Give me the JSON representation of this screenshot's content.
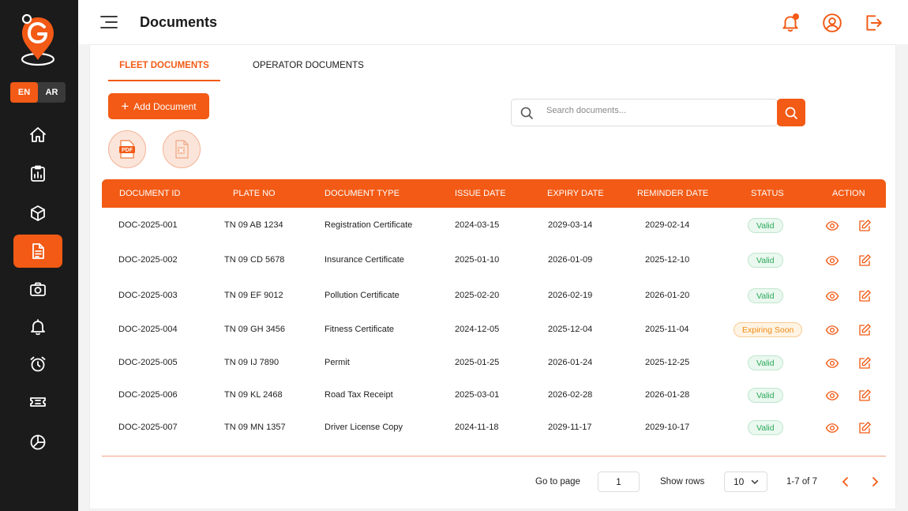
{
  "app": {
    "page_title": "Documents",
    "languages": [
      {
        "label": "EN",
        "active": true
      },
      {
        "label": "AR",
        "active": false
      }
    ],
    "sidebar_icons": [
      "home-icon",
      "report-icon",
      "box-icon",
      "document-icon",
      "camera-icon",
      "bell-icon",
      "alarm-clock-icon",
      "ticket-icon",
      "pie-chart-icon"
    ],
    "active_nav": "document-icon",
    "accent_color": "#f25a15"
  },
  "tabs": [
    {
      "label": "FLEET DOCUMENTS",
      "active": true
    },
    {
      "label": "OPERATOR DOCUMENTS",
      "active": false
    }
  ],
  "toolbar": {
    "add_label": "Add Document",
    "pdf_label": "PDF",
    "search_placeholder": "Search documents..."
  },
  "table": {
    "headers": [
      "DOCUMENT ID",
      "PLATE NO",
      "DOCUMENT TYPE",
      "ISSUE DATE",
      "EXPIRY DATE",
      "REMINDER DATE",
      "STATUS",
      "ACTION"
    ],
    "rows": [
      {
        "id": "DOC-2025-001",
        "plate": "TN 09 AB 1234",
        "type": "Registration Certificate",
        "issue": "2024-03-15",
        "expiry": "2029-03-14",
        "reminder": "2029-02-14",
        "status": "Valid"
      },
      {
        "id": "DOC-2025-002",
        "plate": "TN 09 CD 5678",
        "type": "Insurance Certificate",
        "issue": "2025-01-10",
        "expiry": "2026-01-09",
        "reminder": "2025-12-10",
        "status": "Valid"
      },
      {
        "id": "DOC-2025-003",
        "plate": "TN 09 EF 9012",
        "type": "Pollution Certificate",
        "issue": "2025-02-20",
        "expiry": "2026-02-19",
        "reminder": "2026-01-20",
        "status": "Valid"
      },
      {
        "id": "DOC-2025-004",
        "plate": "TN 09 GH 3456",
        "type": "Fitness Certificate",
        "issue": "2024-12-05",
        "expiry": "2025-12-04",
        "reminder": "2025-11-04",
        "status": "Expiring Soon"
      },
      {
        "id": "DOC-2025-005",
        "plate": "TN 09 IJ 7890",
        "type": "Permit",
        "issue": "2025-01-25",
        "expiry": "2026-01-24",
        "reminder": "2025-12-25",
        "status": "Valid"
      },
      {
        "id": "DOC-2025-006",
        "plate": "TN 09 KL 2468",
        "type": "Road Tax Receipt",
        "issue": "2025-03-01",
        "expiry": "2026-02-28",
        "reminder": "2026-01-28",
        "status": "Valid"
      },
      {
        "id": "DOC-2025-007",
        "plate": "TN 09 MN 1357",
        "type": "Driver License Copy",
        "issue": "2024-11-18",
        "expiry": "2029-11-17",
        "reminder": "2029-10-17",
        "status": "Valid"
      }
    ]
  },
  "pagination": {
    "go_to_label": "Go to page",
    "page_value": "1",
    "show_rows_label": "Show rows",
    "rows_value": "10",
    "range_text": "1-7 of 7"
  }
}
